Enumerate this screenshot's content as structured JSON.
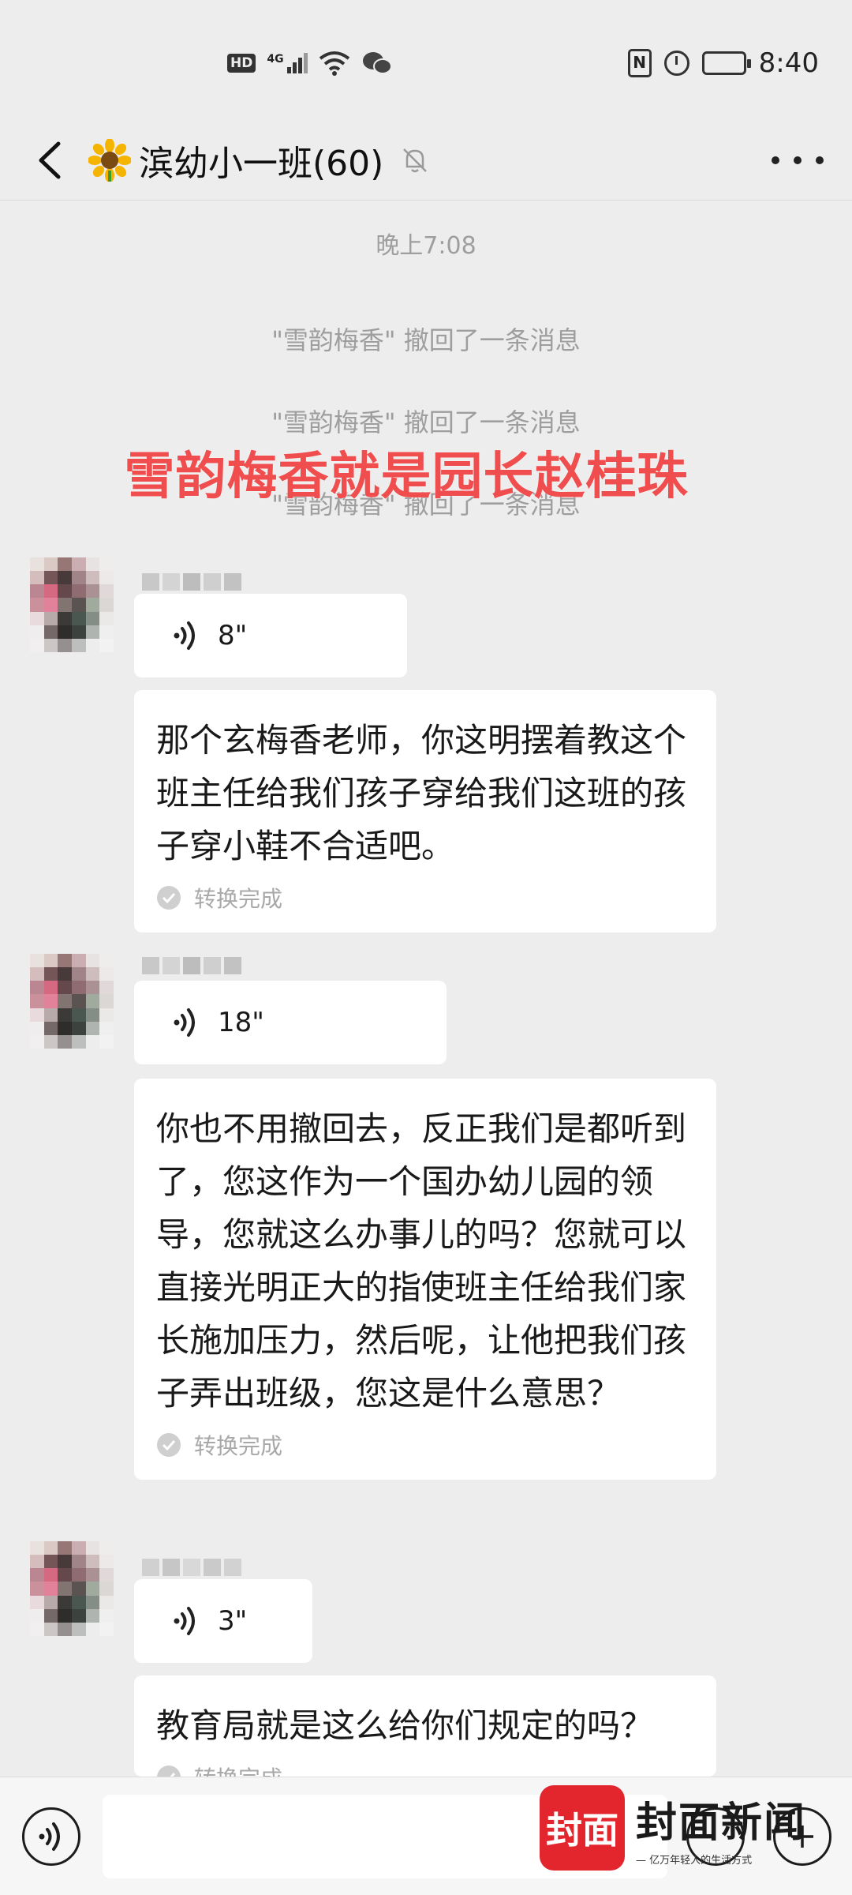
{
  "status_bar": {
    "hd_badge": "HD",
    "network_type": "4G",
    "time": "8:40",
    "nfc": "N"
  },
  "header": {
    "title": "滨幼小一班(60)",
    "title_icon": "sunflower-emoji",
    "muted_icon": "bell-off-icon"
  },
  "chat": {
    "timestamp": "晚上7:08",
    "system_messages": [
      "\"雪韵梅香\" 撤回了一条消息",
      "\"雪韵梅香\" 撤回了一条消息",
      "\"雪韵梅香\" 撤回了一条消息"
    ],
    "overlay_caption": "雪韵梅香就是园长赵桂珠",
    "messages": [
      {
        "voice_duration": "8\"",
        "transcript": "那个玄梅香老师，你这明摆着教这个班主任给我们孩子穿给我们这班的孩子穿小鞋不合适吧。",
        "transcript_status": "转换完成"
      },
      {
        "voice_duration": "18\"",
        "transcript": "你也不用撤回去，反正我们是都听到了，您这作为一个国办幼儿园的领导，您就这么办事儿的吗？您就可以直接光明正大的指使班主任给我们家长施加压力，然后呢，让他把我们孩子弄出班级，您这是什么意思？",
        "transcript_status": "转换完成"
      },
      {
        "voice_duration": "3\"",
        "transcript": "教育局就是这么给你们规定的吗？",
        "transcript_status": "转换完成"
      }
    ]
  },
  "watermark": {
    "logo_text": "封面",
    "brand": "封面新闻",
    "slogan": "— 亿万年轻人的生活方式"
  },
  "colors": {
    "background": "#ededed",
    "bubble": "#ffffff",
    "caption_red": "#f04e4e",
    "brand_red": "#e3262e"
  }
}
